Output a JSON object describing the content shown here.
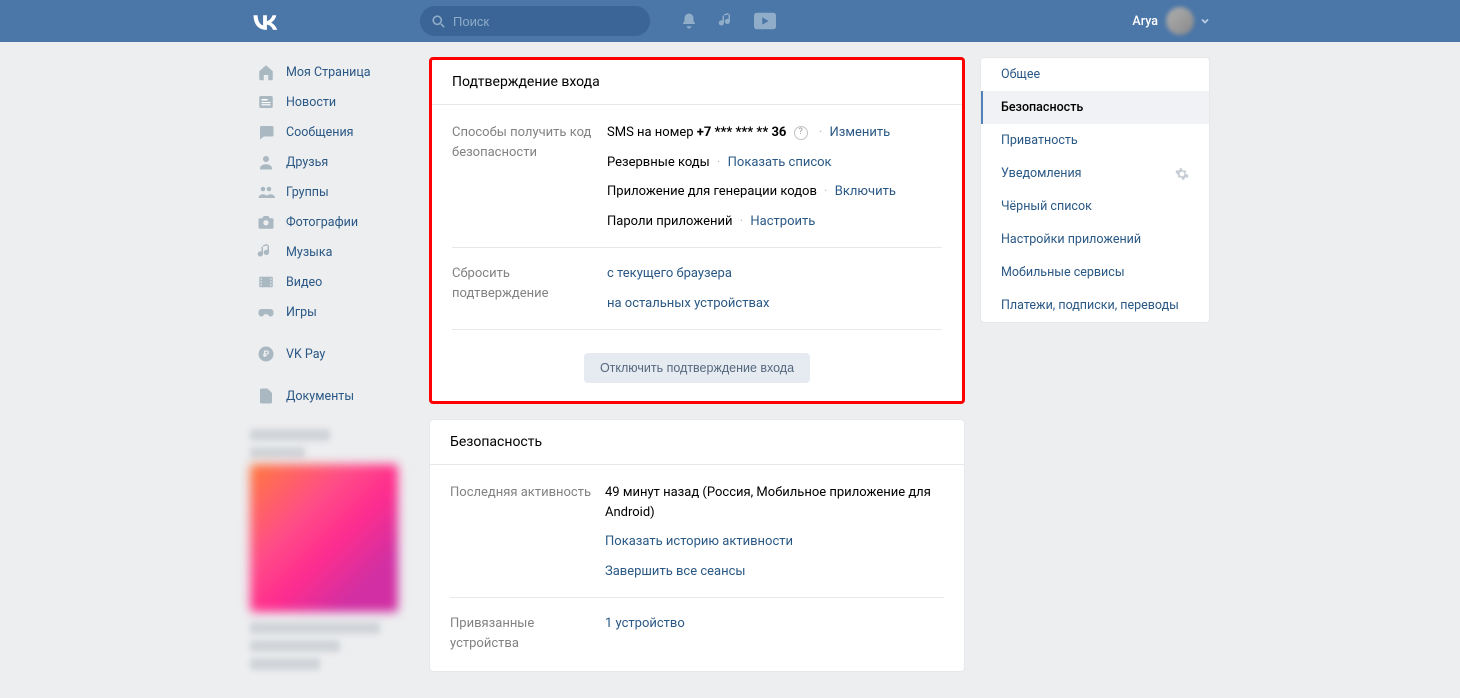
{
  "header": {
    "search_placeholder": "Поиск",
    "username": "Arya"
  },
  "left_nav": [
    {
      "id": "my-page",
      "label": "Моя Страница"
    },
    {
      "id": "news",
      "label": "Новости"
    },
    {
      "id": "messages",
      "label": "Сообщения"
    },
    {
      "id": "friends",
      "label": "Друзья"
    },
    {
      "id": "groups",
      "label": "Группы"
    },
    {
      "id": "photos",
      "label": "Фотографии"
    },
    {
      "id": "music",
      "label": "Музыка"
    },
    {
      "id": "video",
      "label": "Видео"
    },
    {
      "id": "games",
      "label": "Игры"
    },
    {
      "id": "vkpay",
      "label": "VK Pay"
    },
    {
      "id": "docs",
      "label": "Документы"
    }
  ],
  "confirmation": {
    "title": "Подтверждение входа",
    "methods_label": "Способы получить код безопасности",
    "sms_prefix": "SMS на номер ",
    "sms_number": "+7 *** *** ** 36",
    "change": "Изменить",
    "backup_codes": "Резервные коды",
    "show_list": "Показать список",
    "app_gen": "Приложение для генерации кодов",
    "enable": "Включить",
    "app_passwords": "Пароли приложений",
    "configure": "Настроить",
    "reset_label": "Сбросить подтверждение",
    "reset_current": "с текущего браузера",
    "reset_other": "на остальных устройствах",
    "disable_btn": "Отключить подтверждение входа"
  },
  "security": {
    "title": "Безопасность",
    "last_activity_label": "Последняя активность",
    "last_activity_text": "49 минут назад (Россия, Мобильное приложение для Android)",
    "show_history": "Показать историю активности",
    "end_sessions": "Завершить все сеансы",
    "linked_devices_label": "Привязанные устройства",
    "linked_devices_value": "1 устройство"
  },
  "right_menu": [
    {
      "id": "general",
      "label": "Общее",
      "active": false
    },
    {
      "id": "security",
      "label": "Безопасность",
      "active": true
    },
    {
      "id": "privacy",
      "label": "Приватность",
      "active": false
    },
    {
      "id": "notifications",
      "label": "Уведомления",
      "active": false,
      "gear": true
    },
    {
      "id": "blacklist",
      "label": "Чёрный список",
      "active": false
    },
    {
      "id": "apps",
      "label": "Настройки приложений",
      "active": false
    },
    {
      "id": "mobile",
      "label": "Мобильные сервисы",
      "active": false
    },
    {
      "id": "payments",
      "label": "Платежи, подписки, переводы",
      "active": false
    }
  ]
}
